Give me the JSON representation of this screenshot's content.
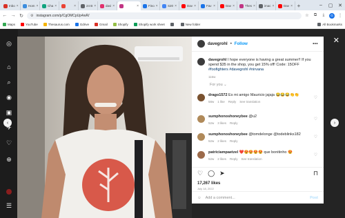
{
  "browser": {
    "tabs": [
      {
        "label": "Inbo",
        "color": "#d93025"
      },
      {
        "label": "Hom",
        "color": "#3c8dde"
      },
      {
        "label": "Cha",
        "color": "#10a37f"
      },
      {
        "label": "",
        "color": "#ea4335"
      },
      {
        "label": "24 B",
        "color": "#5f6368"
      },
      {
        "label": "davi",
        "color": "#e1306c"
      },
      {
        "label": "",
        "color": "#c13584",
        "active": true
      },
      {
        "label": "Fino",
        "color": "#1a73e8"
      },
      {
        "label": "S20",
        "color": "#4285f4"
      },
      {
        "label": "Dav",
        "color": "#ff0000"
      },
      {
        "label": "Fav",
        "color": "#1a73e8"
      },
      {
        "label": "Dav",
        "color": "#ff0000"
      },
      {
        "label": "Thes",
        "color": "#c13584"
      },
      {
        "label": "imac",
        "color": "#5f6368"
      },
      {
        "label": "Dav",
        "color": "#ff0000"
      }
    ],
    "url": "instagram.com/p/CgOMCpUp4wR/",
    "bookmarks": [
      {
        "label": "Maps",
        "color": "#34a853"
      },
      {
        "label": "YouTube",
        "color": "#ff0000"
      },
      {
        "label": "Thesaurus.com",
        "color": "#f4b400"
      },
      {
        "label": "Gdrive",
        "color": "#1a73e8"
      },
      {
        "label": "Gmail",
        "color": "#d93025"
      },
      {
        "label": "Shopify",
        "color": "#95bf47"
      },
      {
        "label": "Shopify work sheet",
        "color": "#0f9d58"
      },
      {
        "label": "",
        "color": "#5f6368"
      },
      {
        "label": "New folder",
        "color": "#5f6368"
      }
    ],
    "all_bookmarks": "All Bookmarks"
  },
  "post": {
    "username": "davegrohl",
    "follow": "Follow",
    "caption": "I hope everyone is having a great summer!! If you spend $35 in the shop, you get 15% off! Code: 15OFF",
    "hashtags": "#foofighters #davegrohl #nirvana",
    "caption_age": "116w",
    "for_you": "For you",
    "comments": [
      {
        "user": "drago1572",
        "text": "Es mi amigo Mauricio jajaja 😂😂😂👏👏",
        "age": "58w",
        "likes": "1 like",
        "reply": "Reply",
        "translation": "See translation",
        "avatar_color": "#7a5230"
      },
      {
        "user": "sumphonoshoneybee",
        "text": "@u2",
        "age": "52w",
        "likes": "3 likes",
        "reply": "Reply",
        "translation": "",
        "avatar_color": "#b08a5a"
      },
      {
        "user": "sumphonoshoneybee",
        "text": "@tomdelonge @todeblinks182",
        "age": "52w",
        "likes": "2 likes",
        "reply": "Reply",
        "translation": "",
        "avatar_color": "#b08a5a"
      },
      {
        "user": "patriciampaetzel",
        "text": "❤️😍😍😍😍 que bonitinho 😍",
        "age": "52w",
        "likes": "2 likes",
        "reply": "Reply",
        "translation": "See translation",
        "avatar_color": "#9c6a4a"
      }
    ],
    "likes": "17,267 likes",
    "date": "July 18, 2022",
    "add_comment_placeholder": "Add a comment...",
    "post_label": "Post"
  },
  "icons": {
    "close": "✕",
    "left": "‹",
    "right": "›"
  }
}
